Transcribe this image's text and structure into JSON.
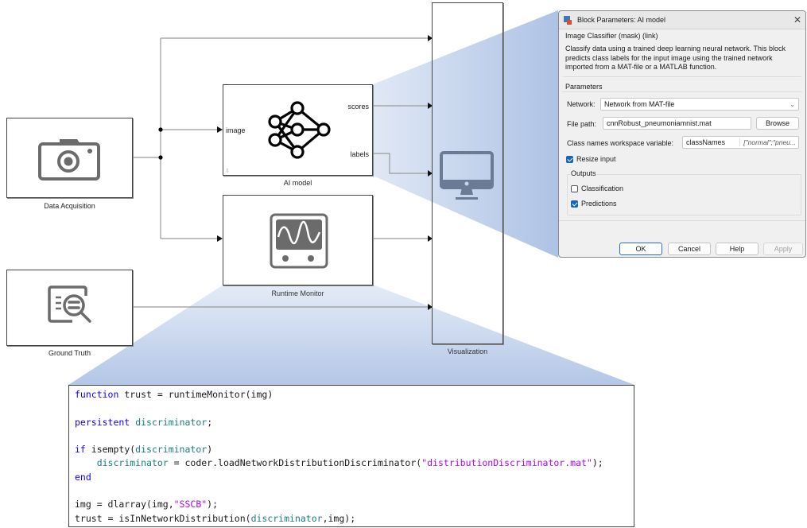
{
  "diagram": {
    "blocks": {
      "data_acquisition": {
        "label": "Data Acquisition",
        "icon": "camera-icon"
      },
      "ground_truth": {
        "label": "Ground Truth",
        "icon": "document-search-icon"
      },
      "ai_model": {
        "label": "AI model",
        "icon": "neural-network-icon",
        "input_port": "image",
        "output_ports": [
          "scores",
          "labels"
        ]
      },
      "runtime_monitor": {
        "label": "Runtime Monitor",
        "icon": "oscilloscope-icon"
      },
      "visualization": {
        "label": "Visualization",
        "icon": "monitor-icon"
      }
    },
    "colors": {
      "highlight": "#a9bfe3",
      "line": "#9a9a9a",
      "block_border": "#444444",
      "icon_gray": "#6b6b6b"
    }
  },
  "dialog": {
    "title": "Block Parameters: AI model",
    "close_glyph": "✕",
    "header_group": "Image Classifier (mask) (link)",
    "description": "Classify data using a trained deep learning neural network. This block predicts class labels for the input image using the trained network imported from a MAT-file or a MATLAB function.",
    "parameters_group": "Parameters",
    "network_label": "Network:",
    "network_value": "Network from MAT-file",
    "file_path_label": "File path:",
    "file_path_value": "cnnRobust_pneumoniamnist.mat",
    "browse_label": "Browse",
    "class_names_label": "Class names workspace variable:",
    "class_names_value": "classNames",
    "class_names_preview": "[\"normal\";\"pneu...",
    "resize_input_label": "Resize input",
    "resize_input_checked": true,
    "outputs_group": "Outputs",
    "classification_label": "Classification",
    "classification_checked": false,
    "predictions_label": "Predictions",
    "predictions_checked": true,
    "buttons": {
      "ok": "OK",
      "cancel": "Cancel",
      "help": "Help",
      "apply": "Apply"
    }
  },
  "code": {
    "lines": [
      [
        {
          "t": "function",
          "c": "kw"
        },
        {
          "t": " trust = runtimeMonitor(img)"
        }
      ],
      [],
      [
        {
          "t": "persistent",
          "c": "kw"
        },
        {
          "t": " "
        },
        {
          "t": "discriminator",
          "c": "var"
        },
        {
          "t": ";"
        }
      ],
      [],
      [
        {
          "t": "if",
          "c": "kw"
        },
        {
          "t": " isempty("
        },
        {
          "t": "discriminator",
          "c": "var"
        },
        {
          "t": ")"
        }
      ],
      [
        {
          "t": "    "
        },
        {
          "t": "discriminator",
          "c": "var"
        },
        {
          "t": " = coder.loadNetworkDistributionDiscriminator("
        },
        {
          "t": "\"distributionDiscriminator.mat\"",
          "c": "str"
        },
        {
          "t": ");"
        }
      ],
      [
        {
          "t": "end",
          "c": "kw"
        }
      ],
      [],
      [
        {
          "t": "img = dlarray(img,"
        },
        {
          "t": "\"SSCB\"",
          "c": "str"
        },
        {
          "t": ");"
        }
      ],
      [
        {
          "t": "trust = isInNetworkDistribution("
        },
        {
          "t": "discriminator",
          "c": "var"
        },
        {
          "t": ",img);"
        }
      ]
    ]
  }
}
